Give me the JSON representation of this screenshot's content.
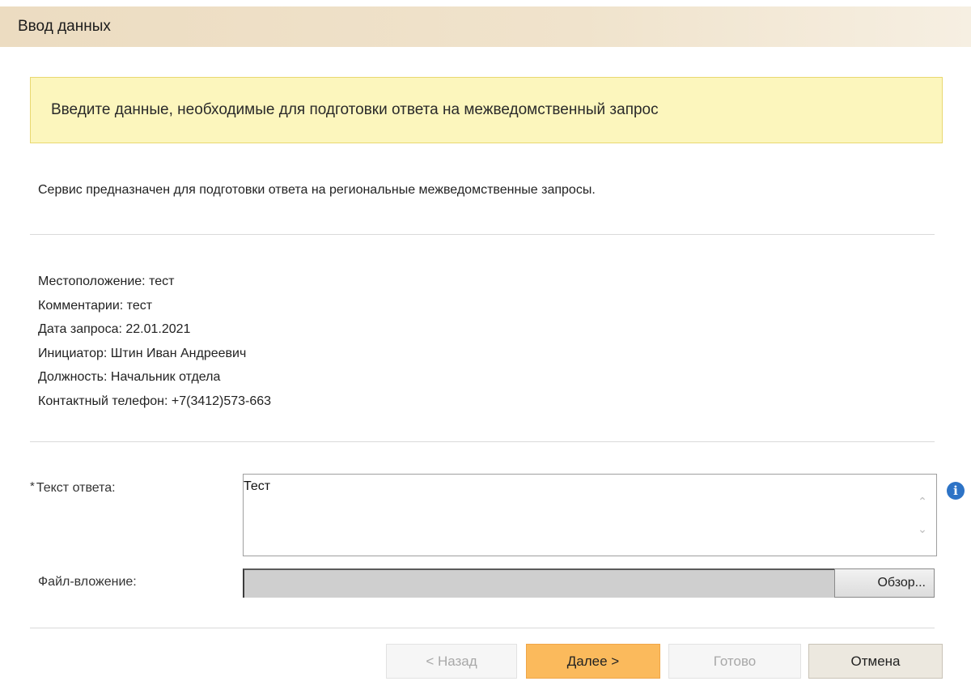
{
  "header": {
    "title": "Ввод данных"
  },
  "notice": {
    "text": "Введите данные, необходимые для подготовки ответа на межведомственный запрос"
  },
  "description": "Сервис предназначен для подготовки ответа на региональные межведомственные запросы.",
  "details": [
    "Местоположение: тест",
    "Комментарии: тест",
    "Дата запроса: 22.01.2021",
    "Инициатор: Штин Иван Андреевич",
    "Должность: Начальник отдела",
    "Контактный телефон: +7(3412)573-663"
  ],
  "form": {
    "required_mark": "*",
    "answer_label": "Текст ответа:",
    "answer_value": "Тест",
    "attachment_label": "Файл-вложение:",
    "browse_label": "Обзор..."
  },
  "buttons": {
    "back": "< Назад",
    "next": "Далее >",
    "done": "Готово",
    "cancel": "Отмена"
  },
  "icons": {
    "info": "info-icon",
    "scroll_up": "chevron-up-icon",
    "scroll_down": "chevron-down-icon"
  },
  "colors": {
    "header_bg": "#ecdcc1",
    "notice_bg": "#fcf6bd",
    "primary_button": "#fbba5c",
    "info_icon": "#2d73c6"
  }
}
